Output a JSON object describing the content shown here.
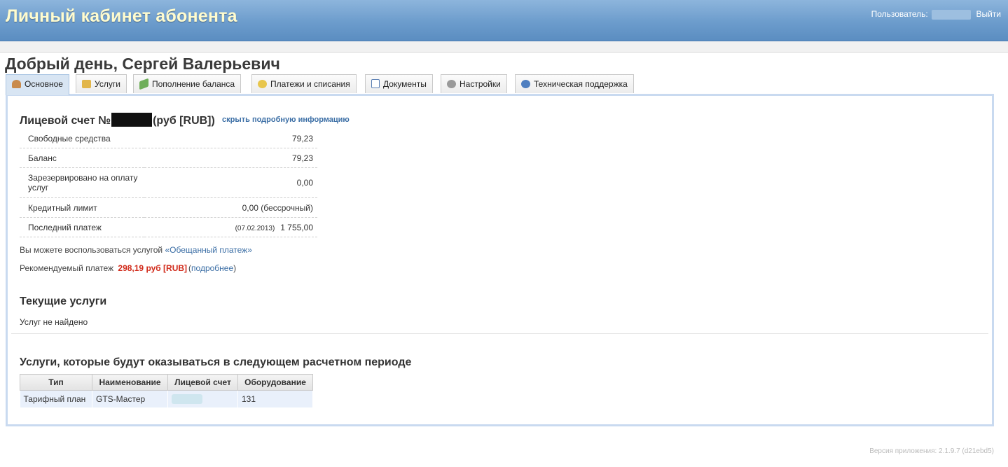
{
  "header": {
    "app_title": "Личный кабинет абонента",
    "user_label": "Пользователь:",
    "logout_label": "Выйти",
    "brand_color": "#6c9ccc",
    "title_color": "#fffccf"
  },
  "greeting": "Добрый день, Сергей Валерьевич",
  "tabs": [
    {
      "label": "Основное",
      "icon": "user-icon",
      "active": true
    },
    {
      "label": "Услуги",
      "icon": "box-icon",
      "active": false
    },
    {
      "label": "Пополнение баланса",
      "icon": "money-icon",
      "active": false
    },
    {
      "label": "Платежи и списания",
      "icon": "coins-icon",
      "active": false
    },
    {
      "label": "Документы",
      "icon": "document-icon",
      "active": false
    },
    {
      "label": "Настройки",
      "icon": "gear-icon",
      "active": false
    },
    {
      "label": "Техническая поддержка",
      "icon": "help-icon",
      "active": false
    }
  ],
  "account": {
    "title_prefix": "Лицевой счет №",
    "title_suffix": "(руб [RUB])",
    "toggle_link": "скрыть подробную информацию",
    "rows": [
      {
        "label": "Свободные средства",
        "value": "79,23"
      },
      {
        "label": "Баланс",
        "value": "79,23"
      },
      {
        "label": "Зарезервировано на оплату услуг",
        "value": "0,00"
      },
      {
        "label": "Кредитный лимит",
        "value": "0,00 (бессрочный)"
      },
      {
        "label": "Последний платеж",
        "date": "(07.02.2013)",
        "value": "1 755,00"
      }
    ],
    "promise_text": "Вы можете воспользоваться услугой",
    "promise_link": "«Обещанный платеж»",
    "recommend_label": "Рекомендуемый платеж",
    "recommend_amount": "298,19 руб [RUB]",
    "recommend_link": "подробнее",
    "recommend_color": "#d12a1a"
  },
  "current_services": {
    "title": "Текущие услуги",
    "empty_text": "Услуг не найдено"
  },
  "next_period": {
    "title": "Услуги, которые будут оказываться в следующем расчетном периоде",
    "columns": [
      "Тип",
      "Наименование",
      "Лицевой счет",
      "Оборудование"
    ],
    "rows": [
      {
        "type": "Тарифный план",
        "name": "GTS-Мастер",
        "account": "",
        "equipment": "131"
      }
    ]
  },
  "footer": {
    "version": "Версия приложения: 2.1.9.7 (d21ebd5)"
  }
}
